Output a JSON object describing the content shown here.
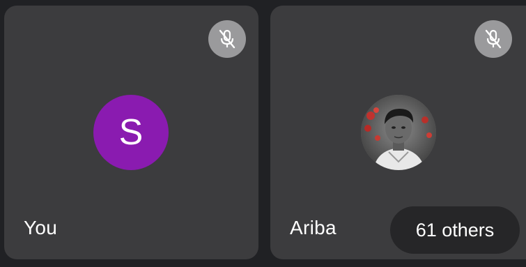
{
  "participants": [
    {
      "name": "You",
      "avatar_initial": "S",
      "avatar_color": "#8a1bb0",
      "mic_state": "muted",
      "mic_icon": "mic-off-icon"
    },
    {
      "name": "Ariba",
      "avatar_type": "photo",
      "mic_state": "muted",
      "mic_icon": "mic-off-icon"
    }
  ],
  "overflow": {
    "label": "61 others"
  },
  "colors": {
    "background": "#202124",
    "tile": "#3c3c3e",
    "mute_button": "#9a9a9c",
    "pill": "#262628",
    "text": "#ffffff"
  }
}
